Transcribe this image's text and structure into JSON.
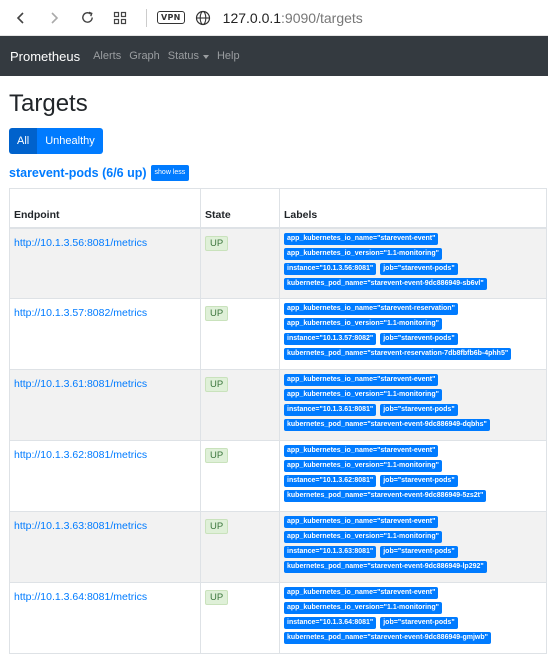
{
  "browser": {
    "vpn_label": "VPN",
    "url_host": "127.0.0.1",
    "url_port": ":9090",
    "url_path": "/targets"
  },
  "navbar": {
    "brand": "Prometheus",
    "links": [
      "Alerts",
      "Graph",
      "Status",
      "Help"
    ]
  },
  "page": {
    "title": "Targets",
    "filter_all": "All",
    "filter_unhealthy": "Unhealthy"
  },
  "pool": {
    "title": "starevent-pods (6/6 up)",
    "toggle_label": "show less",
    "columns": [
      "Endpoint",
      "State",
      "Labels"
    ],
    "rows": [
      {
        "endpoint": "http://10.1.3.56:8081/metrics",
        "state": "UP",
        "labels": [
          "app_kubernetes_io_name=\"starevent-event\"",
          "app_kubernetes_io_version=\"1.1-monitoring\"",
          "instance=\"10.1.3.56:8081\"",
          "job=\"starevent-pods\"",
          "kubernetes_pod_name=\"starevent-event-9dc886949-sb6vl\""
        ]
      },
      {
        "endpoint": "http://10.1.3.57:8082/metrics",
        "state": "UP",
        "labels": [
          "app_kubernetes_io_name=\"starevent-reservation\"",
          "app_kubernetes_io_version=\"1.1-monitoring\"",
          "instance=\"10.1.3.57:8082\"",
          "job=\"starevent-pods\"",
          "kubernetes_pod_name=\"starevent-reservation-7db8fbfb6b-4phh5\""
        ]
      },
      {
        "endpoint": "http://10.1.3.61:8081/metrics",
        "state": "UP",
        "labels": [
          "app_kubernetes_io_name=\"starevent-event\"",
          "app_kubernetes_io_version=\"1.1-monitoring\"",
          "instance=\"10.1.3.61:8081\"",
          "job=\"starevent-pods\"",
          "kubernetes_pod_name=\"starevent-event-9dc886949-dqbhs\""
        ]
      },
      {
        "endpoint": "http://10.1.3.62:8081/metrics",
        "state": "UP",
        "labels": [
          "app_kubernetes_io_name=\"starevent-event\"",
          "app_kubernetes_io_version=\"1.1-monitoring\"",
          "instance=\"10.1.3.62:8081\"",
          "job=\"starevent-pods\"",
          "kubernetes_pod_name=\"starevent-event-9dc886949-5zs2t\""
        ]
      },
      {
        "endpoint": "http://10.1.3.63:8081/metrics",
        "state": "UP",
        "labels": [
          "app_kubernetes_io_name=\"starevent-event\"",
          "app_kubernetes_io_version=\"1.1-monitoring\"",
          "instance=\"10.1.3.63:8081\"",
          "job=\"starevent-pods\"",
          "kubernetes_pod_name=\"starevent-event-9dc886949-lp292\""
        ]
      },
      {
        "endpoint": "http://10.1.3.64:8081/metrics",
        "state": "UP",
        "labels": [
          "app_kubernetes_io_name=\"starevent-event\"",
          "app_kubernetes_io_version=\"1.1-monitoring\"",
          "instance=\"10.1.3.64:8081\"",
          "job=\"starevent-pods\"",
          "kubernetes_pod_name=\"starevent-event-9dc886949-gmjwb\""
        ]
      }
    ]
  }
}
